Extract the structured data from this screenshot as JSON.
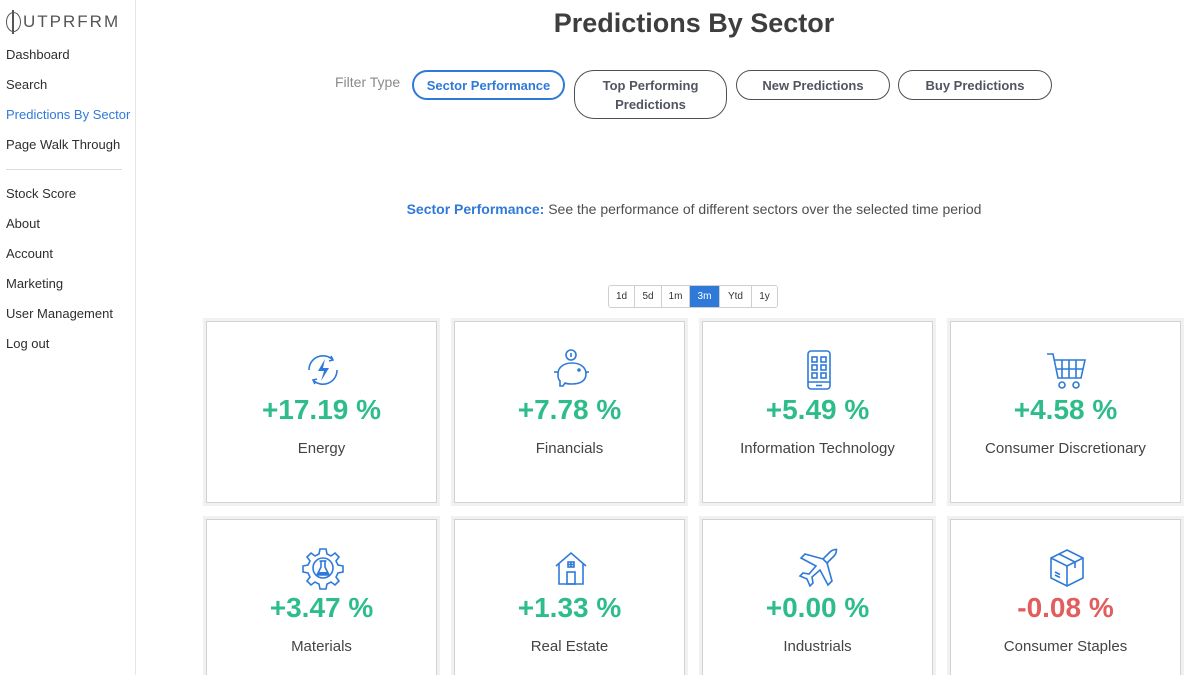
{
  "app": {
    "logo_text": "UTPRFRM"
  },
  "sidebar": {
    "items_top": [
      {
        "label": "Dashboard",
        "active": false
      },
      {
        "label": "Search",
        "active": false
      },
      {
        "label": "Predictions By Sector",
        "active": true
      },
      {
        "label": "Page Walk Through",
        "active": false
      }
    ],
    "items_bottom": [
      {
        "label": "Stock Score"
      },
      {
        "label": "About"
      },
      {
        "label": "Account"
      },
      {
        "label": "Marketing"
      },
      {
        "label": "User Management"
      },
      {
        "label": "Log out"
      }
    ]
  },
  "main": {
    "title": "Predictions By Sector",
    "filter_label": "Filter Type",
    "filters": [
      {
        "label": "Sector Performance",
        "active": true
      },
      {
        "label": "Top Performing Predictions",
        "active": false
      },
      {
        "label": "New Predictions",
        "active": false
      },
      {
        "label": "Buy Predictions",
        "active": false
      }
    ],
    "description_highlight": "Sector Performance:",
    "description_text": " See the performance of different sectors over the selected time period",
    "periods": [
      {
        "label": "1d",
        "active": false
      },
      {
        "label": "5d",
        "active": false
      },
      {
        "label": "1m",
        "active": false
      },
      {
        "label": "3m",
        "active": true
      },
      {
        "label": "Ytd",
        "active": false
      },
      {
        "label": "1y",
        "active": false
      }
    ],
    "sectors": [
      {
        "name": "Energy",
        "value": "+17.19 %",
        "icon": "energy-icon",
        "negative": false
      },
      {
        "name": "Financials",
        "value": "+7.78 %",
        "icon": "piggy-bank-icon",
        "negative": false
      },
      {
        "name": "Information Technology",
        "value": "+5.49 %",
        "icon": "mobile-apps-icon",
        "negative": false
      },
      {
        "name": "Consumer Discretionary",
        "value": "+4.58 %",
        "icon": "shopping-cart-icon",
        "negative": false
      },
      {
        "name": "Materials",
        "value": "+3.47 %",
        "icon": "gear-flask-icon",
        "negative": false
      },
      {
        "name": "Real Estate",
        "value": "+1.33 %",
        "icon": "house-icon",
        "negative": false
      },
      {
        "name": "Industrials",
        "value": "+0.00 %",
        "icon": "airplane-icon",
        "negative": false
      },
      {
        "name": "Consumer Staples",
        "value": "-0.08 %",
        "icon": "box-icon",
        "negative": true
      }
    ]
  },
  "colors": {
    "accent": "#2f7ad9",
    "positive": "#2ebd8a",
    "negative": "#e25d5d"
  }
}
